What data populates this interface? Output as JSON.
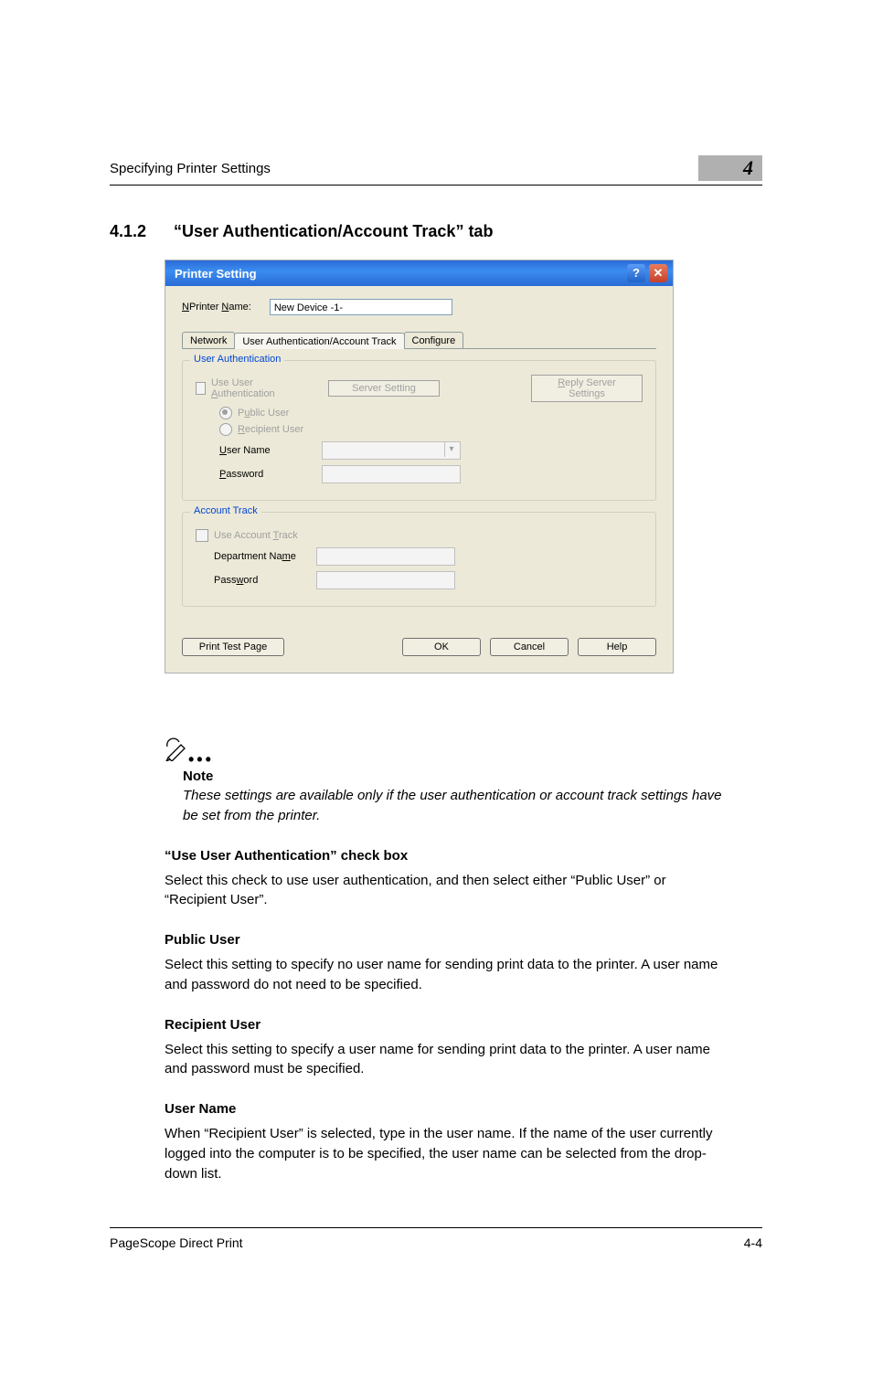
{
  "header": {
    "text": "Specifying Printer Settings",
    "chapter": "4"
  },
  "section": {
    "num": "4.1.2",
    "title": "“User Authentication/Account Track” tab"
  },
  "dialog": {
    "title": "Printer Setting",
    "printer_name_label": "Printer Name:",
    "printer_name_value": "New Device -1-",
    "tabs": {
      "t1": "Network",
      "t2": "User Authentication/Account Track",
      "t3": "Configure"
    },
    "group_auth": {
      "legend": "User Authentication",
      "use_auth": "Use User Authentication",
      "server_setting": "Server Setting",
      "reply_server": "Reply Server Settings",
      "public_user": "Public User",
      "recipient_user": "Recipient User",
      "user_name": "User Name",
      "password": "Password"
    },
    "group_track": {
      "legend": "Account Track",
      "use_track": "Use Account Track",
      "dept": "Department Name",
      "password": "Password"
    },
    "buttons": {
      "test": "Print Test Page",
      "ok": "OK",
      "cancel": "Cancel",
      "help": "Help"
    }
  },
  "note": {
    "head": "Note",
    "body": "These settings are available only if the user authentication or account track settings have be set from the printer."
  },
  "sections": {
    "h1": "“Use User Authentication” check box",
    "p1": "Select this check to use user authentication, and then select either “Public User” or “Recipient User”.",
    "h2": "Public User",
    "p2": "Select this setting to specify no user name for sending print data to the printer. A user name and password do not need to be specified.",
    "h3": "Recipient User",
    "p3": "Select this setting to specify a user name for sending print data to the printer. A user name and password must be specified.",
    "h4": "User Name",
    "p4": "When “Recipient User” is selected, type in the user name. If the name of the user currently logged into the computer is to be specified, the user name can be selected from the drop-down list."
  },
  "footer": {
    "left": "PageScope Direct Print",
    "right": "4-4"
  }
}
